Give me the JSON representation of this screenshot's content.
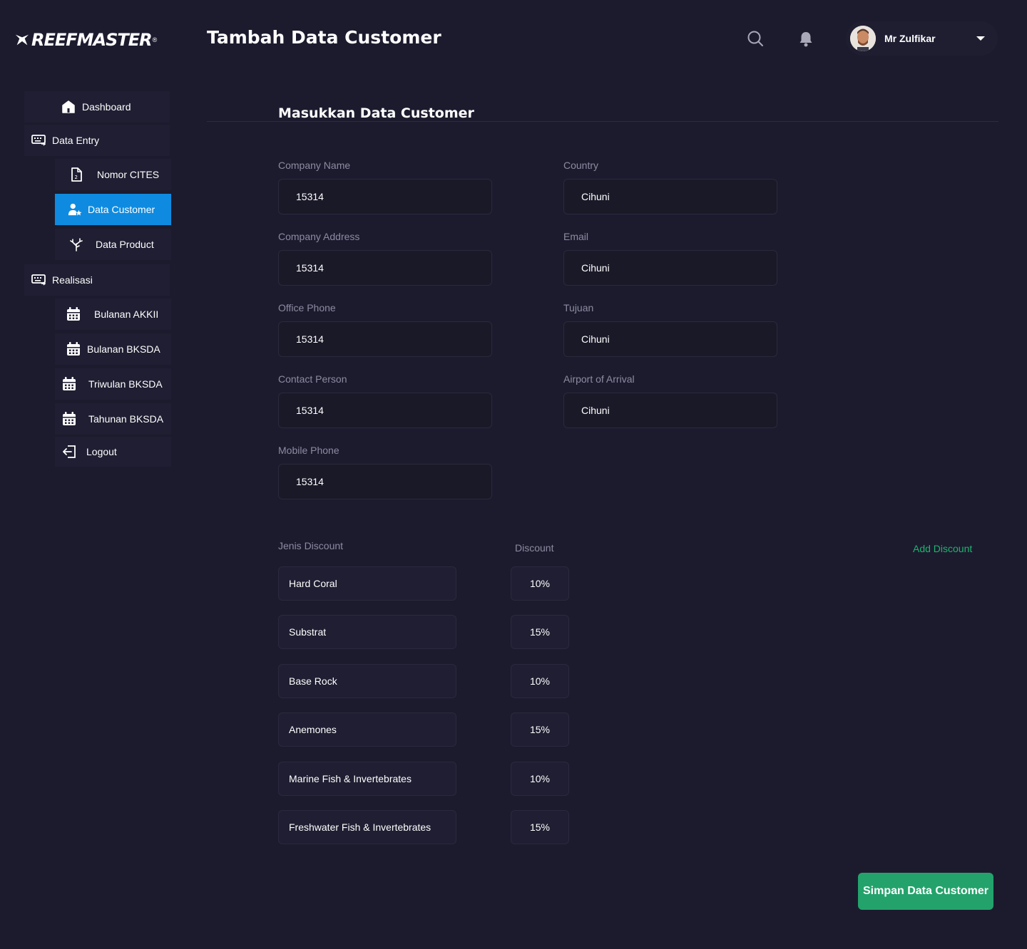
{
  "brand": {
    "name": "REEFMASTER",
    "reg": "®"
  },
  "header": {
    "title": "Tambah Data Customer",
    "user_name": "Mr Zulfikar"
  },
  "sidebar": {
    "items": [
      {
        "label": "Dashboard",
        "icon": "home-icon"
      },
      {
        "label": "Data Entry",
        "icon": "keyboard-icon"
      },
      {
        "label": "Nomor CITES",
        "icon": "document-icon"
      },
      {
        "label": "Data Customer",
        "icon": "user-star-icon",
        "active": true
      },
      {
        "label": "Data Product",
        "icon": "coral-icon"
      },
      {
        "label": "Realisasi",
        "icon": "keyboard-icon"
      },
      {
        "label": "Bulanan AKKII",
        "icon": "calendar-icon"
      },
      {
        "label": "Bulanan BKSDA",
        "icon": "calendar-icon"
      },
      {
        "label": "Triwulan BKSDA",
        "icon": "calendar-icon"
      },
      {
        "label": "Tahunan BKSDA",
        "icon": "calendar-icon"
      },
      {
        "label": "Logout",
        "icon": "logout-icon"
      }
    ]
  },
  "form": {
    "section_title": "Masukkan Data Customer",
    "fields": {
      "company_name": {
        "label": "Company Name",
        "value": "15314"
      },
      "company_address": {
        "label": "Company Address",
        "value": "15314"
      },
      "office_phone": {
        "label": "Office Phone",
        "value": "15314"
      },
      "contact_person": {
        "label": "Contact Person",
        "value": "15314"
      },
      "mobile_phone": {
        "label": "Mobile Phone",
        "value": "15314"
      },
      "country": {
        "label": "Country",
        "value": "Cihuni"
      },
      "email": {
        "label": "Email",
        "value": "Cihuni"
      },
      "tujuan": {
        "label": "Tujuan",
        "value": "Cihuni"
      },
      "airport": {
        "label": "Airport of Arrival",
        "value": "Cihuni"
      }
    }
  },
  "discounts": {
    "type_header": "Jenis Discount",
    "value_header": "Discount",
    "add_label": "Add Discount",
    "rows": [
      {
        "type": "Hard Coral",
        "value": "10%"
      },
      {
        "type": "Substrat",
        "value": "15%"
      },
      {
        "type": "Base Rock",
        "value": "10%"
      },
      {
        "type": "Anemones",
        "value": "15%"
      },
      {
        "type": "Marine Fish & Invertebrates",
        "value": "10%"
      },
      {
        "type": "Freshwater Fish & Invertebrates",
        "value": "15%"
      }
    ]
  },
  "actions": {
    "save_label": "Simpan Data Customer"
  },
  "colors": {
    "background": "#1c1b2e",
    "active": "#0e8be0",
    "accent_green": "#23a36b",
    "link_green": "#1fb46e"
  }
}
